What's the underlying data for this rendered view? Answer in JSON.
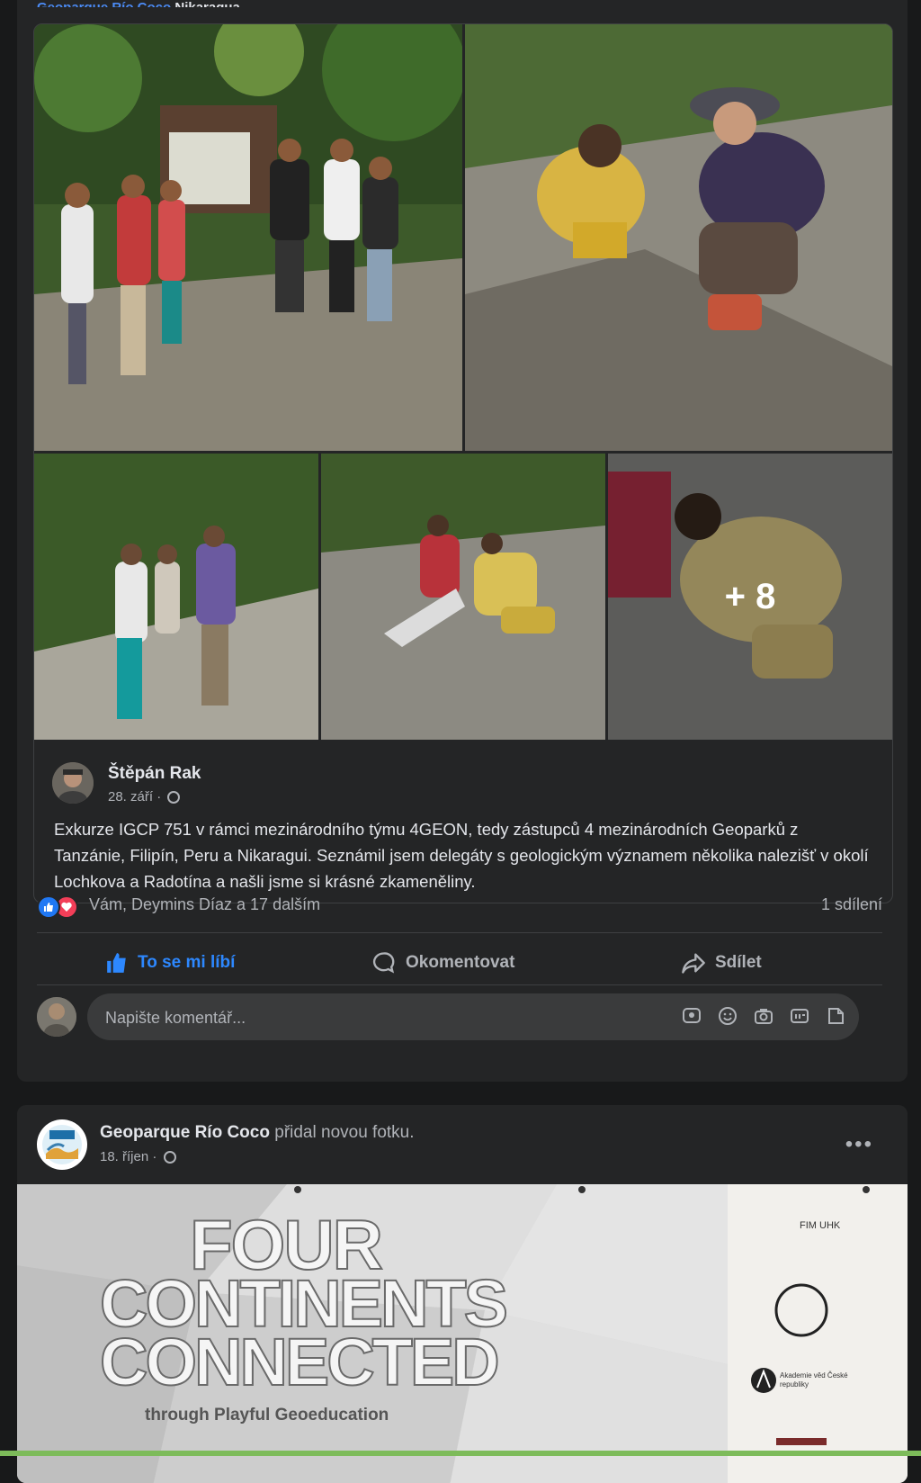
{
  "post1": {
    "header_fragment": {
      "page": "Geoparque Río Coco",
      "country": "Nikaragua"
    },
    "photos": {
      "more_count_label": "+ 8"
    },
    "author": {
      "name": "Štěpán Rak",
      "date": "28. září",
      "separator": "·"
    },
    "text": "Exkurze IGCP 751 v rámci mezinárodního týmu 4GEON, tedy zástupců 4 mezinárodních Geoparků z Tanzánie, Filipín, Peru a Nikaragui. Seznámil jsem delegáty s geologickým významem několika nalezišť v okolí Lochkova a Radotína a našli jsme si krásné zkameněliny.",
    "reactions": {
      "names": "Vám, Deymins Díaz a 17 dalším",
      "shares": "1 sdílení"
    },
    "actions": {
      "like": "To se mi líbí",
      "comment": "Okomentovat",
      "share": "Sdílet"
    },
    "comment_box": {
      "placeholder": "Napište komentář..."
    }
  },
  "post2": {
    "page_name": "Geoparque Río Coco",
    "action_text": "přidal novou fotku.",
    "date": "18. říjen",
    "separator": "·",
    "more_label": "•••",
    "banner": {
      "line1": "FOUR",
      "line2": "CONTINENTS",
      "line3": "CONNECTED",
      "subtitle": "through Playful Geoeducation",
      "logo_text": "FIM UHK",
      "logo2_text": "Akademie věd České republiky"
    }
  },
  "colors": {
    "background": "#18191a",
    "card": "#242526",
    "accent": "#2d88ff",
    "love": "#f33e58"
  },
  "icons": [
    "like-icon",
    "comment-icon",
    "share-icon",
    "globe-icon",
    "sticker-icon",
    "emoji-icon",
    "camera-icon",
    "gif-icon",
    "avatar-sticker-icon",
    "more-icon"
  ]
}
